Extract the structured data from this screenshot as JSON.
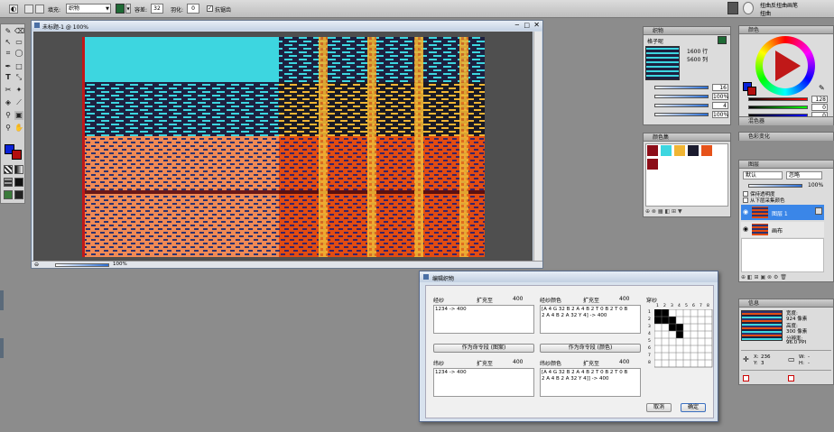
{
  "options_bar": {
    "fill_label": "填充:",
    "fill_value": "织物",
    "tolerance_label": "容差:",
    "tolerance_value": "32",
    "feather_label": "羽化:",
    "feather_value": "0",
    "antialias_label": "抗锯齿",
    "brush_panel_line1": "扭曲反扭曲画笔",
    "brush_panel_line2": "扭曲"
  },
  "canvas_window": {
    "title": "未标题-1 @ 100%",
    "zoom": "100%"
  },
  "fabric_panel": {
    "title": "织物",
    "name": "格子呢",
    "dims1": "1600 行",
    "dims2": "5600 列",
    "values": [
      "16",
      "100%",
      "4",
      "100%"
    ]
  },
  "color_panel": {
    "title": "颜色",
    "readouts": [
      "128",
      "0",
      "0"
    ],
    "mixer": "混色器",
    "variation": "色彩变化"
  },
  "swatch_panel": {
    "title": "颜色集",
    "colors": [
      "#8c0d18",
      "#3dd6e0",
      "#f0b534",
      "#1b1b2e",
      "#e6521a",
      "#8c0d18"
    ]
  },
  "layers_panel": {
    "title": "图层",
    "mode": "默认",
    "composite": "忽略",
    "opacity": "100%",
    "check1": "保持透明度",
    "check2": "从下层采集颜色",
    "layer1": "图层 1",
    "layer2": "画布"
  },
  "info_panel": {
    "title": "信息",
    "width_label": "宽度:",
    "width_value": "924 像素",
    "height_label": "高度:",
    "height_value": "300 像素",
    "res_label": "分辨率:",
    "res_value": "96.0 PPI",
    "x_label": "X:",
    "x_value": "236",
    "y_label": "Y:",
    "y_value": "3",
    "w_label": "W:",
    "w_value": "-",
    "h_label": "H:",
    "h_value": "-"
  },
  "weave_dialog": {
    "title": "编辑织物",
    "warp_label": "经纱",
    "expand_label": "扩充至",
    "expand_value": "400",
    "warp_colors_label": "经纱颜色",
    "warp_text": "1234 -> 400",
    "warp_colors_text": "[A 4 G 32 B 2 A 4 B 2 T 0 B 2 T 0 B\n2 A 4 B 2 A 32 Y 4] -> 400",
    "tieup_label": "穿纱",
    "make_pattern_btn": "作为命令段 (图案)",
    "make_color_btn": "作为命令段 (颜色)",
    "weft_label": "纬纱",
    "weft_colors_label": "纬纱颜色",
    "weft_text": "1234 -> 400",
    "weft_colors_text": "[A 4 G 32 B 2 A 4 B 2 T 0 B 2 T 0 B\n2 A 4 B 2 A 32 Y 4]] -> 400",
    "cancel_btn": "取消",
    "ok_btn": "确定",
    "grid_numbers": [
      "1",
      "2",
      "3",
      "4",
      "5",
      "6",
      "7",
      "8"
    ]
  }
}
